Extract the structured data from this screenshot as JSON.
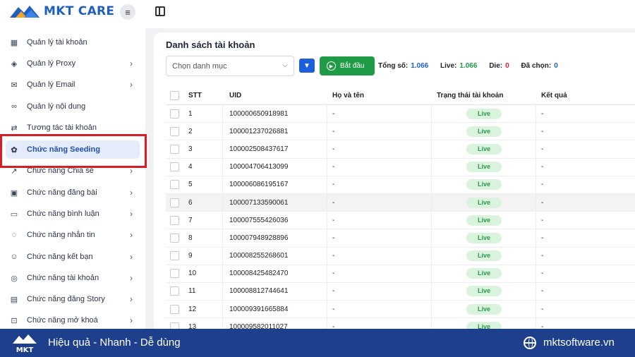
{
  "brand": {
    "name": "MKT CARE",
    "primary_color": "#1f5fbf",
    "accent_color": "#f5a623"
  },
  "topbar": {
    "menu_icon": "hamburger-icon",
    "layout_icon": "layout-icon"
  },
  "sidebar": {
    "items": [
      {
        "label": "Quản lý tài khoản",
        "icon": "grid-icon",
        "chevron": false,
        "active": false
      },
      {
        "label": "Quản lý Proxy",
        "icon": "layers-icon",
        "chevron": true,
        "active": false
      },
      {
        "label": "Quản lý Email",
        "icon": "mail-icon",
        "chevron": true,
        "active": false
      },
      {
        "label": "Quản lý nội dung",
        "icon": "link-icon",
        "chevron": false,
        "active": false
      },
      {
        "label": "Tương tác tài khoản",
        "icon": "interact-icon",
        "chevron": false,
        "active": false
      },
      {
        "label": "Chức năng Seeding",
        "icon": "seed-icon",
        "chevron": false,
        "active": true
      },
      {
        "label": "Chức năng Chia sẻ",
        "icon": "share-icon",
        "chevron": true,
        "active": false
      },
      {
        "label": "Chức năng đăng bài",
        "icon": "post-icon",
        "chevron": true,
        "active": false
      },
      {
        "label": "Chức năng bình luận",
        "icon": "comment-icon",
        "chevron": true,
        "active": false
      },
      {
        "label": "Chức năng nhắn tin",
        "icon": "message-icon",
        "chevron": true,
        "active": false
      },
      {
        "label": "Chức năng kết bạn",
        "icon": "add-friend-icon",
        "chevron": true,
        "active": false
      },
      {
        "label": "Chức năng tài khoản",
        "icon": "account-icon",
        "chevron": true,
        "active": false
      },
      {
        "label": "Chức năng đăng Story",
        "icon": "story-icon",
        "chevron": true,
        "active": false
      },
      {
        "label": "Chức năng mở khoá",
        "icon": "unlock-icon",
        "chevron": true,
        "active": false
      }
    ]
  },
  "main": {
    "title": "Danh sách tài khoản",
    "category_select": {
      "placeholder": "Chọn danh mục"
    },
    "start_button": "Bắt đầu",
    "stats": {
      "total_label": "Tổng số:",
      "total_value": "1.066",
      "live_label": "Live:",
      "live_value": "1.066",
      "die_label": "Die:",
      "die_value": "0",
      "selected_label": "Đã chọn:",
      "selected_value": "0"
    },
    "table": {
      "headers": {
        "stt": "STT",
        "uid": "UID",
        "name": "Họ và tên",
        "status": "Trạng thái tài khoản",
        "result": "Kết quả"
      },
      "rows": [
        {
          "stt": "1",
          "uid": "100000650918981",
          "name": "-",
          "status": "Live",
          "result": "-"
        },
        {
          "stt": "2",
          "uid": "100001237026881",
          "name": "-",
          "status": "Live",
          "result": "-"
        },
        {
          "stt": "3",
          "uid": "100002508437617",
          "name": "-",
          "status": "Live",
          "result": "-"
        },
        {
          "stt": "4",
          "uid": "100004706413099",
          "name": "-",
          "status": "Live",
          "result": "-"
        },
        {
          "stt": "5",
          "uid": "100006086195167",
          "name": "-",
          "status": "Live",
          "result": "-"
        },
        {
          "stt": "6",
          "uid": "100007133590061",
          "name": "-",
          "status": "Live",
          "result": "-"
        },
        {
          "stt": "7",
          "uid": "100007555426036",
          "name": "-",
          "status": "Live",
          "result": "-"
        },
        {
          "stt": "8",
          "uid": "100007948928896",
          "name": "-",
          "status": "Live",
          "result": "-"
        },
        {
          "stt": "9",
          "uid": "100008255268601",
          "name": "-",
          "status": "Live",
          "result": "-"
        },
        {
          "stt": "10",
          "uid": "100008425482470",
          "name": "-",
          "status": "Live",
          "result": "-"
        },
        {
          "stt": "11",
          "uid": "100008812744641",
          "name": "-",
          "status": "Live",
          "result": "-"
        },
        {
          "stt": "12",
          "uid": "100009391665884",
          "name": "-",
          "status": "Live",
          "result": "-"
        },
        {
          "stt": "13",
          "uid": "100009582011027",
          "name": "-",
          "status": "Live",
          "result": "-"
        }
      ]
    }
  },
  "footer": {
    "logo_text": "MKT",
    "slogan": "Hiệu quả - Nhanh - Dễ dùng",
    "website": "mktsoftware.vn",
    "bg_color": "#1d3f8c"
  }
}
